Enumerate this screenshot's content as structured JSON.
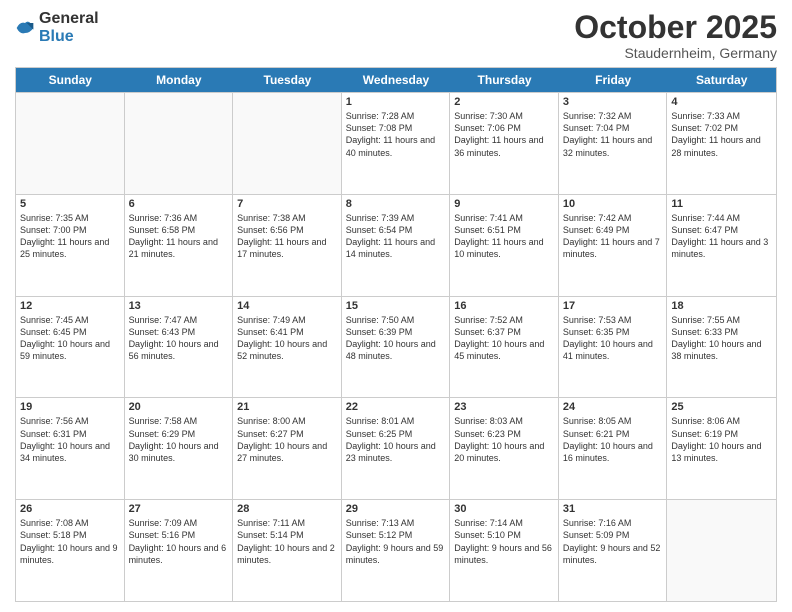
{
  "header": {
    "logo": {
      "general": "General",
      "blue": "Blue"
    },
    "month": "October 2025",
    "location": "Staudernheim, Germany"
  },
  "days": [
    "Sunday",
    "Monday",
    "Tuesday",
    "Wednesday",
    "Thursday",
    "Friday",
    "Saturday"
  ],
  "weeks": [
    [
      {
        "day": "",
        "empty": true
      },
      {
        "day": "",
        "empty": true
      },
      {
        "day": "",
        "empty": true
      },
      {
        "day": "1",
        "sunrise": "7:28 AM",
        "sunset": "7:08 PM",
        "daylight": "11 hours and 40 minutes."
      },
      {
        "day": "2",
        "sunrise": "7:30 AM",
        "sunset": "7:06 PM",
        "daylight": "11 hours and 36 minutes."
      },
      {
        "day": "3",
        "sunrise": "7:32 AM",
        "sunset": "7:04 PM",
        "daylight": "11 hours and 32 minutes."
      },
      {
        "day": "4",
        "sunrise": "7:33 AM",
        "sunset": "7:02 PM",
        "daylight": "11 hours and 28 minutes."
      }
    ],
    [
      {
        "day": "5",
        "sunrise": "7:35 AM",
        "sunset": "7:00 PM",
        "daylight": "11 hours and 25 minutes."
      },
      {
        "day": "6",
        "sunrise": "7:36 AM",
        "sunset": "6:58 PM",
        "daylight": "11 hours and 21 minutes."
      },
      {
        "day": "7",
        "sunrise": "7:38 AM",
        "sunset": "6:56 PM",
        "daylight": "11 hours and 17 minutes."
      },
      {
        "day": "8",
        "sunrise": "7:39 AM",
        "sunset": "6:54 PM",
        "daylight": "11 hours and 14 minutes."
      },
      {
        "day": "9",
        "sunrise": "7:41 AM",
        "sunset": "6:51 PM",
        "daylight": "11 hours and 10 minutes."
      },
      {
        "day": "10",
        "sunrise": "7:42 AM",
        "sunset": "6:49 PM",
        "daylight": "11 hours and 7 minutes."
      },
      {
        "day": "11",
        "sunrise": "7:44 AM",
        "sunset": "6:47 PM",
        "daylight": "11 hours and 3 minutes."
      }
    ],
    [
      {
        "day": "12",
        "sunrise": "7:45 AM",
        "sunset": "6:45 PM",
        "daylight": "10 hours and 59 minutes."
      },
      {
        "day": "13",
        "sunrise": "7:47 AM",
        "sunset": "6:43 PM",
        "daylight": "10 hours and 56 minutes."
      },
      {
        "day": "14",
        "sunrise": "7:49 AM",
        "sunset": "6:41 PM",
        "daylight": "10 hours and 52 minutes."
      },
      {
        "day": "15",
        "sunrise": "7:50 AM",
        "sunset": "6:39 PM",
        "daylight": "10 hours and 48 minutes."
      },
      {
        "day": "16",
        "sunrise": "7:52 AM",
        "sunset": "6:37 PM",
        "daylight": "10 hours and 45 minutes."
      },
      {
        "day": "17",
        "sunrise": "7:53 AM",
        "sunset": "6:35 PM",
        "daylight": "10 hours and 41 minutes."
      },
      {
        "day": "18",
        "sunrise": "7:55 AM",
        "sunset": "6:33 PM",
        "daylight": "10 hours and 38 minutes."
      }
    ],
    [
      {
        "day": "19",
        "sunrise": "7:56 AM",
        "sunset": "6:31 PM",
        "daylight": "10 hours and 34 minutes."
      },
      {
        "day": "20",
        "sunrise": "7:58 AM",
        "sunset": "6:29 PM",
        "daylight": "10 hours and 30 minutes."
      },
      {
        "day": "21",
        "sunrise": "8:00 AM",
        "sunset": "6:27 PM",
        "daylight": "10 hours and 27 minutes."
      },
      {
        "day": "22",
        "sunrise": "8:01 AM",
        "sunset": "6:25 PM",
        "daylight": "10 hours and 23 minutes."
      },
      {
        "day": "23",
        "sunrise": "8:03 AM",
        "sunset": "6:23 PM",
        "daylight": "10 hours and 20 minutes."
      },
      {
        "day": "24",
        "sunrise": "8:05 AM",
        "sunset": "6:21 PM",
        "daylight": "10 hours and 16 minutes."
      },
      {
        "day": "25",
        "sunrise": "8:06 AM",
        "sunset": "6:19 PM",
        "daylight": "10 hours and 13 minutes."
      }
    ],
    [
      {
        "day": "26",
        "sunrise": "7:08 AM",
        "sunset": "5:18 PM",
        "daylight": "10 hours and 9 minutes."
      },
      {
        "day": "27",
        "sunrise": "7:09 AM",
        "sunset": "5:16 PM",
        "daylight": "10 hours and 6 minutes."
      },
      {
        "day": "28",
        "sunrise": "7:11 AM",
        "sunset": "5:14 PM",
        "daylight": "10 hours and 2 minutes."
      },
      {
        "day": "29",
        "sunrise": "7:13 AM",
        "sunset": "5:12 PM",
        "daylight": "9 hours and 59 minutes."
      },
      {
        "day": "30",
        "sunrise": "7:14 AM",
        "sunset": "5:10 PM",
        "daylight": "9 hours and 56 minutes."
      },
      {
        "day": "31",
        "sunrise": "7:16 AM",
        "sunset": "5:09 PM",
        "daylight": "9 hours and 52 minutes."
      },
      {
        "day": "",
        "empty": true
      }
    ]
  ]
}
